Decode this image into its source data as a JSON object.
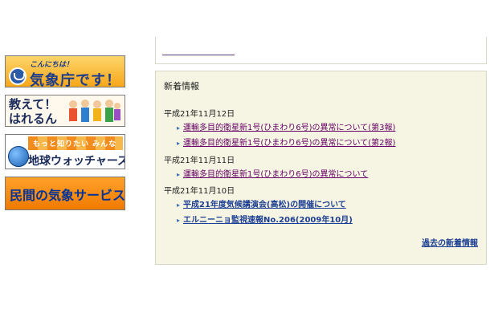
{
  "banners": [
    {
      "small": "こんにちは！",
      "big": "気象庁です！"
    },
    {
      "line1": "教えて！",
      "line2": "はれるん"
    },
    {
      "strip": "もっと知りたい みんなの空",
      "big": "地球ウォッチャーズ"
    },
    {
      "big": "民間の気象サービス"
    }
  ],
  "news": {
    "title": "新着情報",
    "groups": [
      {
        "date": "平成21年11月12日",
        "items": [
          "運輸多目的衛星新1号(ひまわり6号)の異常について(第3報)",
          "運輸多目的衛星新1号(ひまわり6号)の異常について(第2報)"
        ]
      },
      {
        "date": "平成21年11月11日",
        "items": [
          "運輸多目的衛星新1号(ひまわり6号)の異常について"
        ]
      },
      {
        "date": "平成21年11月10日",
        "items": [
          "平成21年度気候講演会(高松)の開催について",
          "エルニーニョ監視速報No.206(2009年10月)"
        ]
      }
    ],
    "more_label": "過去の新着情報"
  },
  "colors": {
    "panel_bg": "#f6f4e2",
    "visited_link": "#660066",
    "link": "#1c3f94"
  }
}
